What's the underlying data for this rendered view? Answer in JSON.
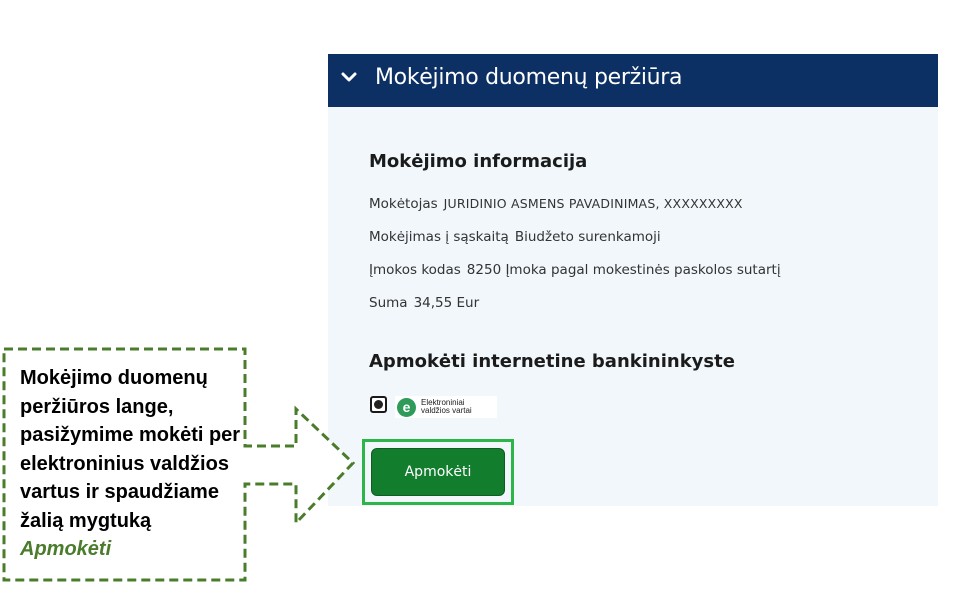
{
  "panel": {
    "header_title": "Mokėjimo duomenų peržiūra",
    "payment_info": {
      "heading": "Mokėjimo informacija",
      "rows": [
        {
          "label": "Mokėtojas",
          "value": "JURIDINIO ASMENS PAVADINIMAS, XXXXXXXXX"
        },
        {
          "label": "Mokėjimas į sąskaitą",
          "value": "Biudžeto surenkamoji"
        },
        {
          "label": "Įmokos kodas",
          "value": "8250 Įmoka pagal mokestinės paskolos sutartį"
        },
        {
          "label": "Suma",
          "value": "34,55 Eur"
        }
      ]
    },
    "bank_section": {
      "heading": "Apmokėti internetine bankininkyste",
      "provider_logo_text": "Elektroniniai\nvaldžios vartai",
      "provider_logo_mark": "e"
    },
    "pay_button_label": "Apmokėti"
  },
  "callout": {
    "text": "Mokėjimo duomenų peržiūros lange, pasižymime mokėti per elektroninius valdžios vartus ir spaudžiame žalią mygtuką ",
    "highlight": "Apmokėti"
  },
  "colors": {
    "header_bg": "#0c2f64",
    "panel_bg": "#f1f7fb",
    "pay_button": "#137d2e",
    "pay_highlight_frame": "#2cb64a",
    "callout_border": "#4a7c2c"
  },
  "icons": [
    "chevron-down-icon",
    "radio-selected-icon",
    "evv-logo-icon"
  ]
}
